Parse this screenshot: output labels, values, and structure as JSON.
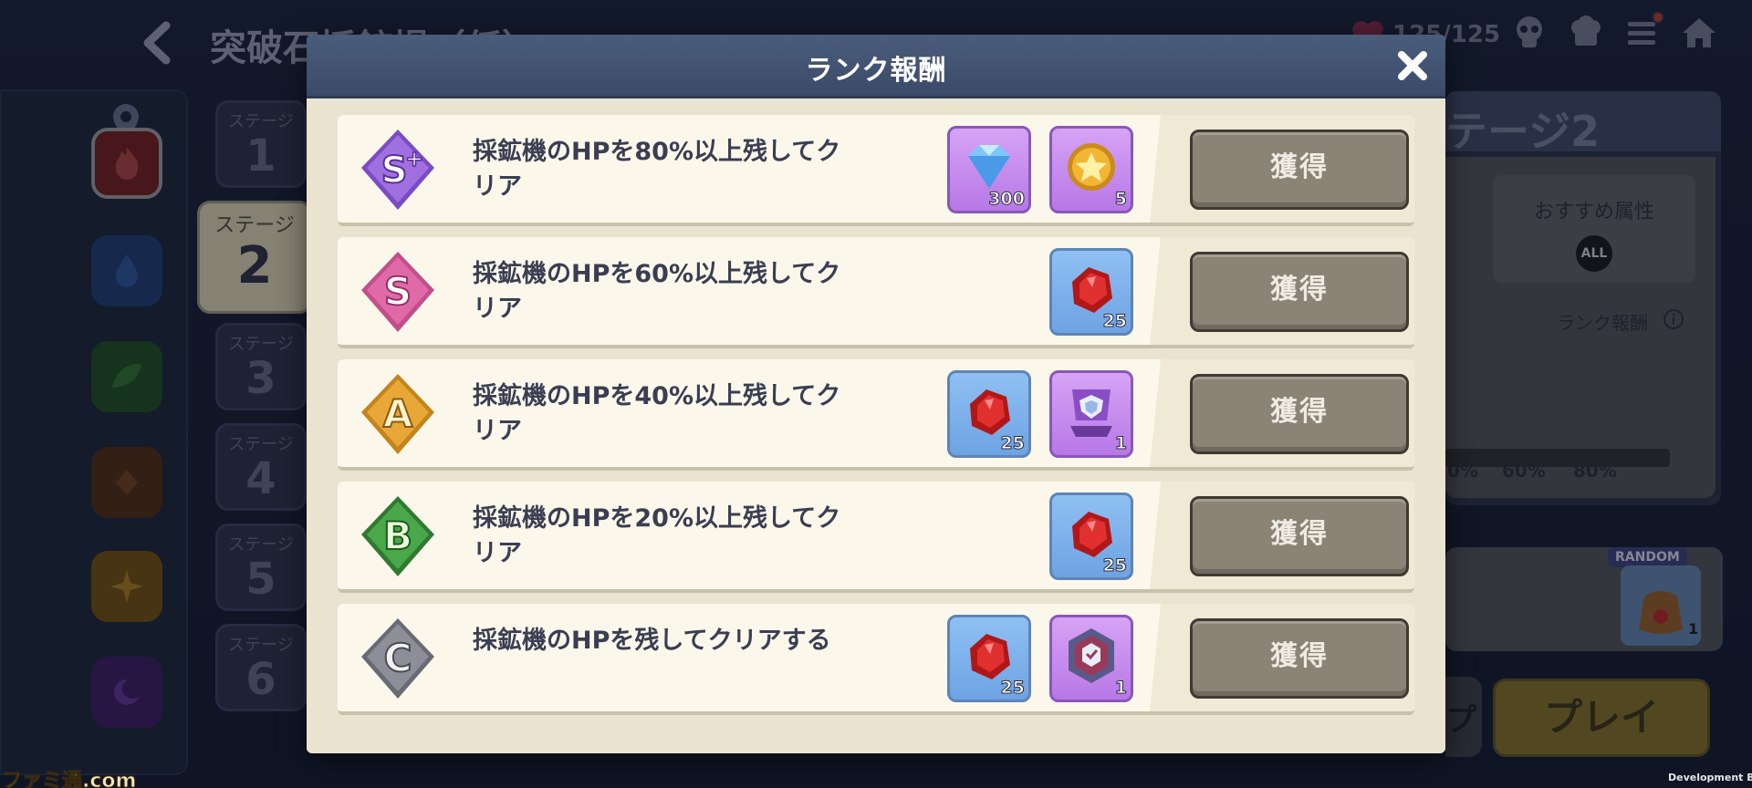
{
  "background": {
    "screen_title": "突破石採鉱場（仮）",
    "stamina": "125/125",
    "attributes": [
      "fire-icon",
      "water-drop-icon",
      "leaf-icon",
      "dark-crystal-icon",
      "star-sparkle-icon",
      "moon-icon"
    ],
    "stages": [
      {
        "label": "ステージ",
        "num": "1"
      },
      {
        "label": "ステージ",
        "num": "2"
      },
      {
        "label": "ステージ",
        "num": "3"
      },
      {
        "label": "ステージ",
        "num": "4"
      },
      {
        "label": "ステージ",
        "num": "5"
      },
      {
        "label": "ステージ",
        "num": "6"
      }
    ],
    "detail": {
      "stage_title": "テージ2",
      "recommended_label": "おすすめ属性",
      "recommended_badge": "ALL",
      "rank_reward_label": "ランク報酬",
      "progress_labels": [
        "0%",
        "60%",
        "80%"
      ],
      "random_tag": "RANDOM",
      "random_count": "1",
      "skip_label": "プ",
      "play_label": "プレイ"
    },
    "watermark": "ファミ通.com",
    "build_label": "Development Build"
  },
  "modal": {
    "title": "ランク報酬",
    "rows": [
      {
        "rank": "S+",
        "condition": "採鉱機のHPを80%以上残してクリア",
        "rewards": [
          {
            "icon": "diamond-gem-icon",
            "count": "300"
          },
          {
            "icon": "gold-star-medal-icon",
            "count": "5"
          }
        ],
        "button": "獲得"
      },
      {
        "rank": "S",
        "condition": "採鉱機のHPを60%以上残してクリア",
        "rewards": [
          {
            "icon": "red-ore-icon",
            "count": "25"
          }
        ],
        "button": "獲得"
      },
      {
        "rank": "A",
        "condition": "採鉱機のHPを40%以上残してクリア",
        "rewards": [
          {
            "icon": "red-ore-icon",
            "count": "25"
          },
          {
            "icon": "shield-trophy-icon",
            "count": "1"
          }
        ],
        "button": "獲得"
      },
      {
        "rank": "B",
        "condition": "採鉱機のHPを20%以上残してクリア",
        "rewards": [
          {
            "icon": "red-ore-icon",
            "count": "25"
          }
        ],
        "button": "獲得"
      },
      {
        "rank": "C",
        "condition": "採鉱機のHPを残してクリアする",
        "rewards": [
          {
            "icon": "red-ore-icon",
            "count": "25"
          },
          {
            "icon": "emblem-frame-icon",
            "count": "1"
          }
        ],
        "button": "獲得"
      }
    ]
  },
  "colors": {
    "header": "#3a4b68",
    "body": "#e9e3cf",
    "row": "#fbf8eb",
    "button": "#8a8376",
    "rank_splus": "#a070e0",
    "rank_s": "#e06aa8",
    "rank_a": "#e8a838",
    "rank_b": "#4aa84a",
    "rank_c": "#8e8e98"
  }
}
